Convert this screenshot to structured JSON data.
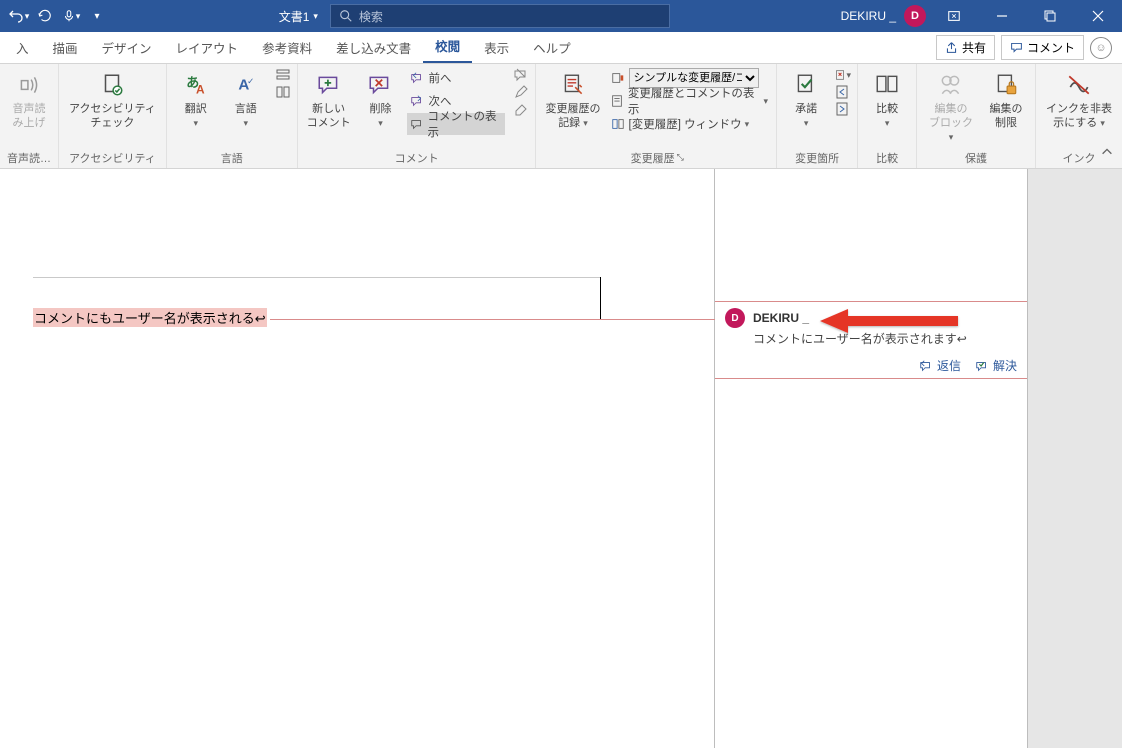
{
  "titlebar": {
    "doc_title": "文書1",
    "search_placeholder": "検索",
    "user_name": "DEKIRU _",
    "avatar_initial": "D"
  },
  "tabs": {
    "items": [
      "入",
      "描画",
      "デザイン",
      "レイアウト",
      "参考資料",
      "差し込み文書",
      "校閲",
      "表示",
      "ヘルプ"
    ],
    "active_index": 6,
    "share": "共有",
    "comment": "コメント"
  },
  "ribbon": {
    "g_voice": {
      "label": "音声読…",
      "btn": "音声読\nみ上げ"
    },
    "g_acc": {
      "label": "アクセシビリティ",
      "btn": "アクセシビリティ\nチェック"
    },
    "g_lang": {
      "label": "言語",
      "translate": "翻訳",
      "language": "言語"
    },
    "g_comment": {
      "label": "コメント",
      "new": "新しい\nコメント",
      "delete": "削除",
      "prev": "前へ",
      "next": "次へ",
      "show": "コメントの表示"
    },
    "g_track": {
      "label": "変更履歴",
      "track": "変更履歴の\n記録",
      "dd": "シンプルな変更履歴/コ…",
      "opt1": "変更履歴とコメントの表示",
      "opt2": "[変更履歴] ウィンドウ"
    },
    "g_changes": {
      "label": "変更箇所",
      "accept": "承諾"
    },
    "g_compare": {
      "label": "比較",
      "btn": "比較"
    },
    "g_protect": {
      "label": "保護",
      "block": "編集の\nブロック",
      "restrict": "編集の\n制限"
    },
    "g_ink": {
      "label": "インク",
      "btn": "インクを非表\n示にする"
    }
  },
  "document": {
    "highlighted_text": "コメントにもユーザー名が表示される"
  },
  "comment_card": {
    "author": "DEKIRU _",
    "avatar_initial": "D",
    "body": "コメントにユーザー名が表示されます",
    "reply": "返信",
    "resolve": "解決"
  }
}
